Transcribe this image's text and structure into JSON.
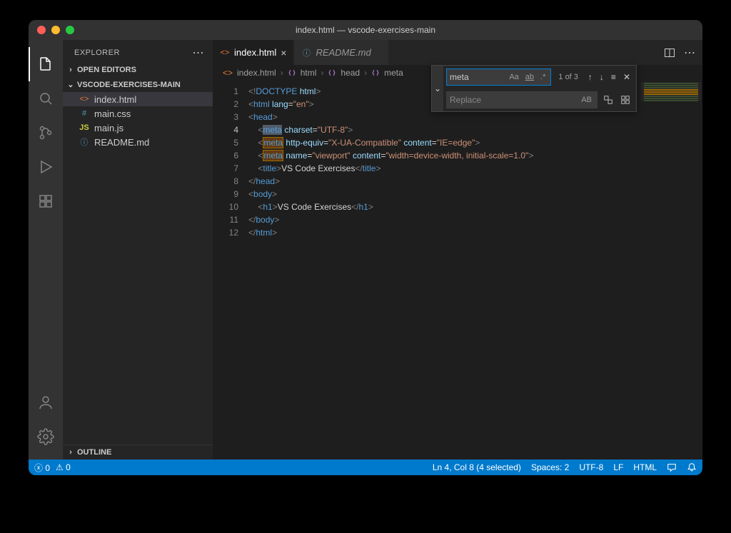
{
  "titlebar": {
    "title": "index.html — vscode-exercises-main"
  },
  "sidebar": {
    "header": "EXPLORER",
    "open_editors": "OPEN EDITORS",
    "folder": "VSCODE-EXERCISES-MAIN",
    "outline": "OUTLINE",
    "files": [
      {
        "name": "index.html",
        "icon": "html"
      },
      {
        "name": "main.css",
        "icon": "css"
      },
      {
        "name": "main.js",
        "icon": "js"
      },
      {
        "name": "README.md",
        "icon": "info"
      }
    ]
  },
  "tabs": [
    {
      "title": "index.html",
      "icon": "html",
      "active": true
    },
    {
      "title": "README.md",
      "icon": "info",
      "active": false
    }
  ],
  "breadcrumb": [
    "index.html",
    "html",
    "head",
    "meta"
  ],
  "find": {
    "search_value": "meta",
    "replace_placeholder": "Replace",
    "count": "1 of 3"
  },
  "code": {
    "lines": [
      {
        "n": 1,
        "html": "<span class='p'>&lt;!</span><span class='dt'>DOCTYPE</span> <span class='attr'>html</span><span class='p'>&gt;</span>"
      },
      {
        "n": 2,
        "html": "<span class='p'>&lt;</span><span class='tag'>html</span> <span class='attr'>lang</span>=<span class='str'>\"en\"</span><span class='p'>&gt;</span>"
      },
      {
        "n": 3,
        "html": "<span class='p'>&lt;</span><span class='tag'>head</span><span class='p'>&gt;</span>"
      },
      {
        "n": 4,
        "current": true,
        "html": "    <span class='p'>&lt;</span><span class='tag'><span class='sel'>meta</span></span> <span class='attr'>charset</span>=<span class='str'>\"UTF-8\"</span><span class='p'>&gt;</span>"
      },
      {
        "n": 5,
        "html": "    <span class='p'>&lt;</span><span class='tag'><span class='match'>meta</span></span> <span class='attr'>http-equiv</span>=<span class='str'>\"X-UA-Compatible\"</span> <span class='attr'>content</span>=<span class='str'>\"IE=edge\"</span><span class='p'>&gt;</span>"
      },
      {
        "n": 6,
        "html": "    <span class='p'>&lt;</span><span class='tag'><span class='match'>meta</span></span> <span class='attr'>name</span>=<span class='str'>\"viewport\"</span> <span class='attr'>content</span>=<span class='str'>\"width=device-width, initial-scale=1.0\"</span><span class='p'>&gt;</span>"
      },
      {
        "n": 7,
        "html": "    <span class='p'>&lt;</span><span class='tag'>title</span><span class='p'>&gt;</span><span class='txt'>VS Code Exercises</span><span class='p'>&lt;/</span><span class='tag'>title</span><span class='p'>&gt;</span>"
      },
      {
        "n": 8,
        "html": "<span class='p'>&lt;/</span><span class='tag'>head</span><span class='p'>&gt;</span>"
      },
      {
        "n": 9,
        "html": "<span class='p'>&lt;</span><span class='tag'>body</span><span class='p'>&gt;</span>"
      },
      {
        "n": 10,
        "html": "    <span class='p'>&lt;</span><span class='tag'>h1</span><span class='p'>&gt;</span><span class='txt'>VS Code Exercises</span><span class='p'>&lt;/</span><span class='tag'>h1</span><span class='p'>&gt;</span>"
      },
      {
        "n": 11,
        "html": "<span class='p'>&lt;/</span><span class='tag'>body</span><span class='p'>&gt;</span>"
      },
      {
        "n": 12,
        "html": "<span class='p'>&lt;/</span><span class='tag'>html</span><span class='p'>&gt;</span>"
      }
    ]
  },
  "status": {
    "errors": "0",
    "warnings": "0",
    "cursor": "Ln 4, Col 8 (4 selected)",
    "spaces": "Spaces: 2",
    "encoding": "UTF-8",
    "eol": "LF",
    "lang": "HTML"
  }
}
